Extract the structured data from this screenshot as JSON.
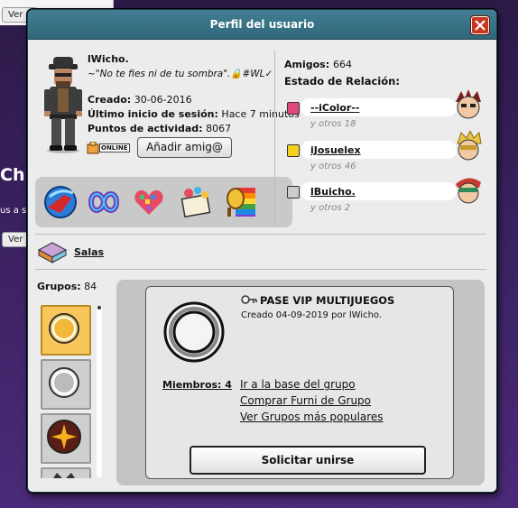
{
  "background": {
    "top_button": "Ver c",
    "heading": "Chu",
    "fragment": "us a se",
    "bottom_button": "Ver"
  },
  "window": {
    "title": "Perfil del usuario"
  },
  "profile": {
    "username": "lWicho.",
    "motto": "~\"No te fies ni de tu sombra\".🔒#WL✓",
    "created_label": "Creado:",
    "created_value": "30-06-2016",
    "last_login_label": "Último inicio de sesión:",
    "last_login_value": "Hace 7 minutos",
    "activity_label": "Puntos de actividad:",
    "activity_value": "8067",
    "online_badge": "ONLINE",
    "add_friend_label": "Añadir amig@"
  },
  "badges": [
    "rocket-badge",
    "infinity-badge",
    "pixel-heart-badge",
    "notebook-badge",
    "rainbow-tennis-badge"
  ],
  "relations": {
    "friends_label": "Amigos:",
    "friends_count": "664",
    "status_label": "Estado de Relación:",
    "items": [
      {
        "icon": "heart-icon",
        "name": "--iColor--",
        "others": "y otros 18",
        "color": "#e0477a"
      },
      {
        "icon": "smile-icon",
        "name": "iJosuelex",
        "others": "y otros 46",
        "color": "#f2d21c"
      },
      {
        "icon": "skull-icon",
        "name": "lBuicho.",
        "others": "y otros 2",
        "color": "#cccccc"
      }
    ]
  },
  "rooms": {
    "label": "Salas"
  },
  "groups": {
    "label": "Grupos:",
    "count": "84"
  },
  "group_detail": {
    "name": "PASE VIP MULTIJUEGOS",
    "created": "Creado 04-09-2019 por lWicho.",
    "members_label": "Miembros: 4",
    "links": [
      "Ir a la base del grupo",
      "Comprar Furni de Grupo",
      "Ver Grupos más populares"
    ],
    "join_label": "Solicitar unirse"
  },
  "colors": {
    "title_bar": "#3a7489",
    "close_button": "#c9361f",
    "selected_group": "#f9c65b"
  }
}
